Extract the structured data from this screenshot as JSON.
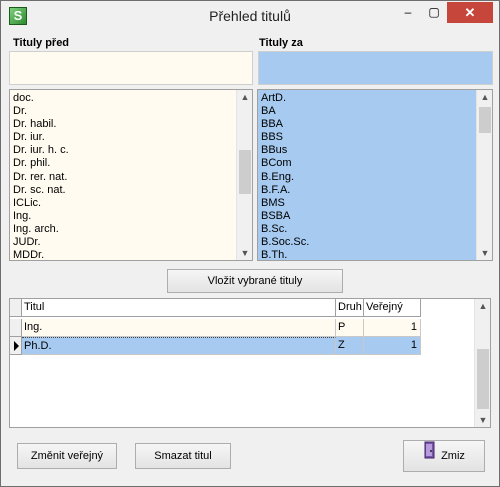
{
  "window": {
    "title": "Přehled titulů",
    "minimize_label": "–",
    "maximize_label": "▢",
    "close_label": "✕",
    "icon_glyph": "S"
  },
  "left": {
    "label": "Tituly před",
    "input_value": "",
    "items": [
      "doc.",
      "Dr.",
      "Dr. habil.",
      "Dr. iur.",
      "Dr. iur. h. c.",
      "Dr. phil.",
      "Dr. rer. nat.",
      "Dr. sc. nat.",
      "ICLic.",
      "Ing.",
      "Ing. arch.",
      "JUDr.",
      "MDDr."
    ]
  },
  "right": {
    "label": "Tituly za",
    "input_value": "",
    "items": [
      "ArtD.",
      "BA",
      "BBA",
      "BBS",
      "BBus",
      "BCom",
      "B.Eng.",
      "B.F.A.",
      "BMS",
      "BSBA",
      "B.Sc.",
      "B.Soc.Sc.",
      "B.Th."
    ]
  },
  "insert_button": "Vložit vybrané tituly",
  "grid": {
    "headers": [
      "Titul",
      "Druh",
      "Veřejný"
    ],
    "rows": [
      {
        "titul": "Ing.",
        "druh": "P",
        "verejny": "1"
      },
      {
        "titul": "Ph.D.",
        "druh": "Z",
        "verejny": "1"
      }
    ]
  },
  "buttons": {
    "change_public": "Změnit veřejný",
    "delete_title": "Smazat titul",
    "close": "Zmiz"
  },
  "colors": {
    "cream": "#fffbf0",
    "selection_blue": "#a6caf0",
    "close_red": "#c7463b"
  }
}
